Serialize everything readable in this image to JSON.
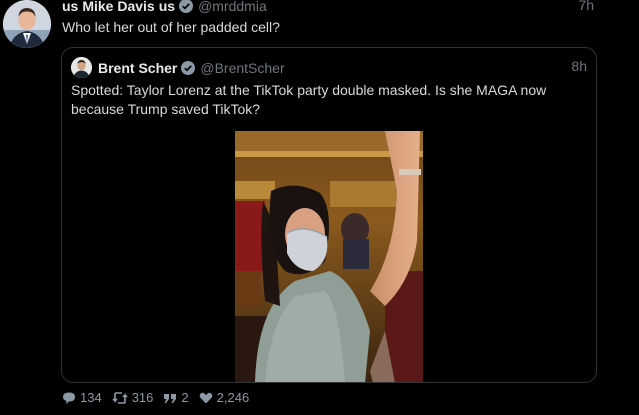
{
  "tweet": {
    "author_prefix": "us",
    "author_name": "Mike Davis",
    "author_suffix": "us",
    "handle": "@mrddmia",
    "time": "7h",
    "text": "Who let her out of her padded cell?",
    "verified_icon": "verified-badge-icon"
  },
  "quote": {
    "author_name": "Brent Scher",
    "handle": "@BrentScher",
    "time": "8h",
    "text": "Spotted: Taylor Lorenz at the TikTok party double masked. Is she MAGA now because Trump saved TikTok?"
  },
  "actions": {
    "replies": "134",
    "retweets": "316",
    "quotes": "2",
    "likes": "2,246"
  },
  "colors": {
    "background": "#000000",
    "verified": "#8b98a5",
    "muted": "#6e767d"
  }
}
